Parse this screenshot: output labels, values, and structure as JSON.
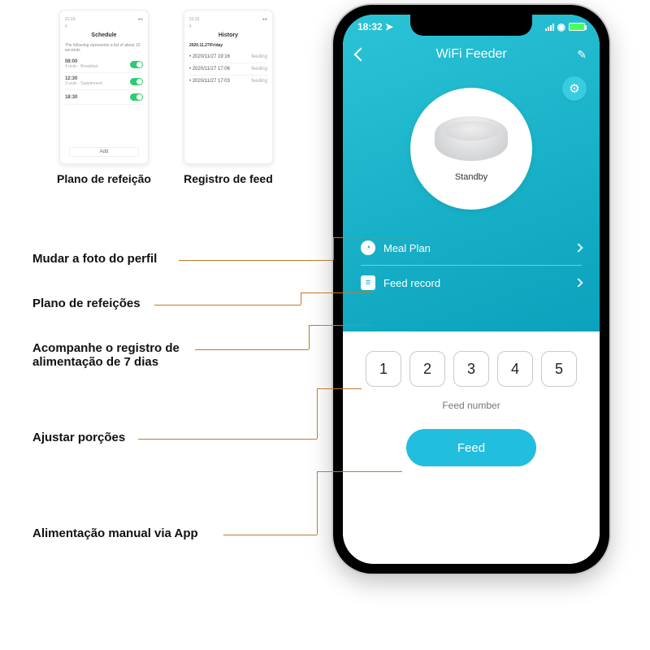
{
  "previews": {
    "schedule": {
      "title": "Schedule",
      "subtitle": "The following represents a list of about 10 seconds",
      "items": [
        {
          "time": "08:00",
          "meta": "4 units · Breakfast",
          "on": true
        },
        {
          "time": "12:30",
          "meta": "3 units · Supplement",
          "on": true
        },
        {
          "time": "18:30",
          "meta": "",
          "on": true
        }
      ],
      "add_label": "Add",
      "caption": "Plano de refeição"
    },
    "history": {
      "title": "History",
      "subtitle": "2020.11.27/Friday",
      "items": [
        {
          "time": "2020/11/27 19:16",
          "status": "feeding"
        },
        {
          "time": "2020/11/27 17:06",
          "status": "feeding"
        },
        {
          "time": "2020/11/27 17:03",
          "status": "feeding"
        }
      ],
      "caption": "Registro de feed"
    }
  },
  "phone": {
    "status": {
      "time": "18:32",
      "nav_icon": "✈"
    },
    "header": {
      "title": "WiFi Feeder"
    },
    "device": {
      "state": "Standby"
    },
    "menu": {
      "meal_plan": "Meal Plan",
      "feed_record": "Feed record"
    },
    "portions": {
      "values": [
        "1",
        "2",
        "3",
        "4",
        "5"
      ],
      "label": "Feed number"
    },
    "feed_button": "Feed"
  },
  "callouts": {
    "profile": "Mudar a foto do perfil",
    "meal_plan": "Plano de refeições",
    "feed_record_l1": "Acompanhe o registro de",
    "feed_record_l2": "alimentação de 7 dias",
    "portions": "Ajustar porções",
    "manual": "Alimentação manual via App"
  }
}
